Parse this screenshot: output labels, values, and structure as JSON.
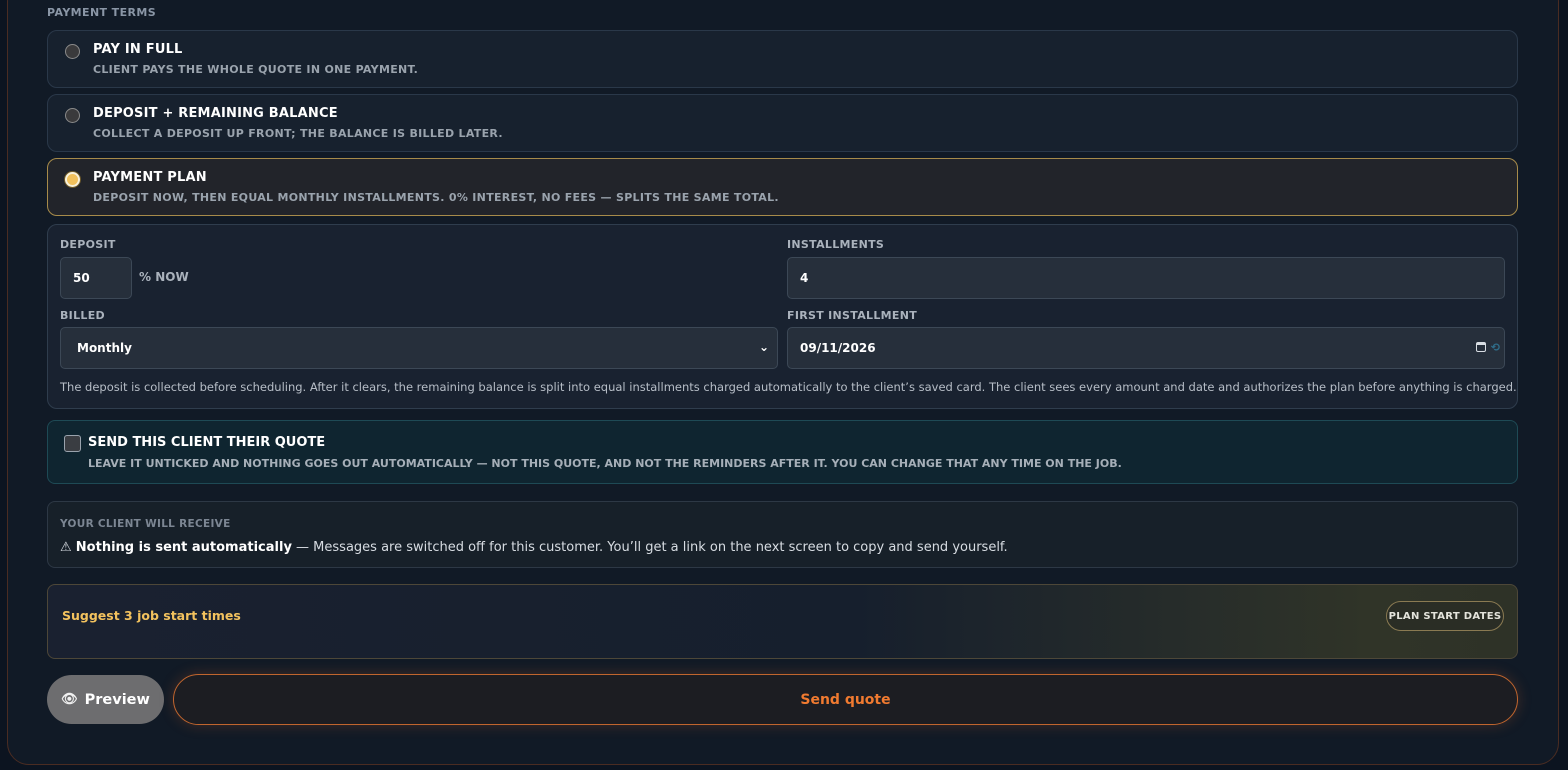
{
  "payment_terms": {
    "section_label": "PAYMENT TERMS",
    "options": [
      {
        "title": "PAY IN FULL",
        "subtitle": "CLIENT PAYS THE WHOLE QUOTE IN ONE PAYMENT.",
        "selected": false
      },
      {
        "title": "DEPOSIT + REMAINING BALANCE",
        "subtitle": "COLLECT A DEPOSIT UP FRONT; THE BALANCE IS BILLED LATER.",
        "selected": false
      },
      {
        "title": "PAYMENT PLAN",
        "subtitle": "DEPOSIT NOW, THEN EQUAL MONTHLY INSTALLMENTS. 0% INTEREST, NO FEES — SPLITS THE SAME TOTAL.",
        "selected": true
      }
    ]
  },
  "plan": {
    "deposit_label": "DEPOSIT",
    "deposit_value": "50",
    "deposit_suffix": "% NOW",
    "installments_label": "INSTALLMENTS",
    "installments_value": "4",
    "billed_label": "BILLED",
    "billed_value": "Monthly",
    "first_installment_label": "FIRST INSTALLMENT",
    "first_installment_value": "09/11/2026",
    "note": "The deposit is collected before scheduling. After it clears, the remaining balance is split into equal installments charged automatically to the client’s saved card. The client sees every amount and date and authorizes the plan before anything is charged."
  },
  "send_toggle": {
    "checked": false,
    "title": "SEND THIS CLIENT THEIR QUOTE",
    "subtitle": "LEAVE IT UNTICKED AND NOTHING GOES OUT AUTOMATICALLY — NOT THIS QUOTE, AND NOT THE REMINDERS AFTER IT. YOU CAN CHANGE THAT ANY TIME ON THE JOB."
  },
  "receive": {
    "label": "YOUR CLIENT WILL RECEIVE",
    "warning_icon": "⚠",
    "warning_bold": "Nothing is sent automatically",
    "warning_rest": " — Messages are switched off for this customer. You’ll get a link on the next screen to copy and send yourself."
  },
  "suggest": {
    "text": "Suggest 3 job start times",
    "button": "PLAN START DATES"
  },
  "actions": {
    "preview_icon": "👁",
    "preview": "Preview",
    "send": "Send quote"
  },
  "colors": {
    "accent_orange": "#f07a30",
    "accent_gold": "#f3c25e",
    "background": "#111a26"
  }
}
